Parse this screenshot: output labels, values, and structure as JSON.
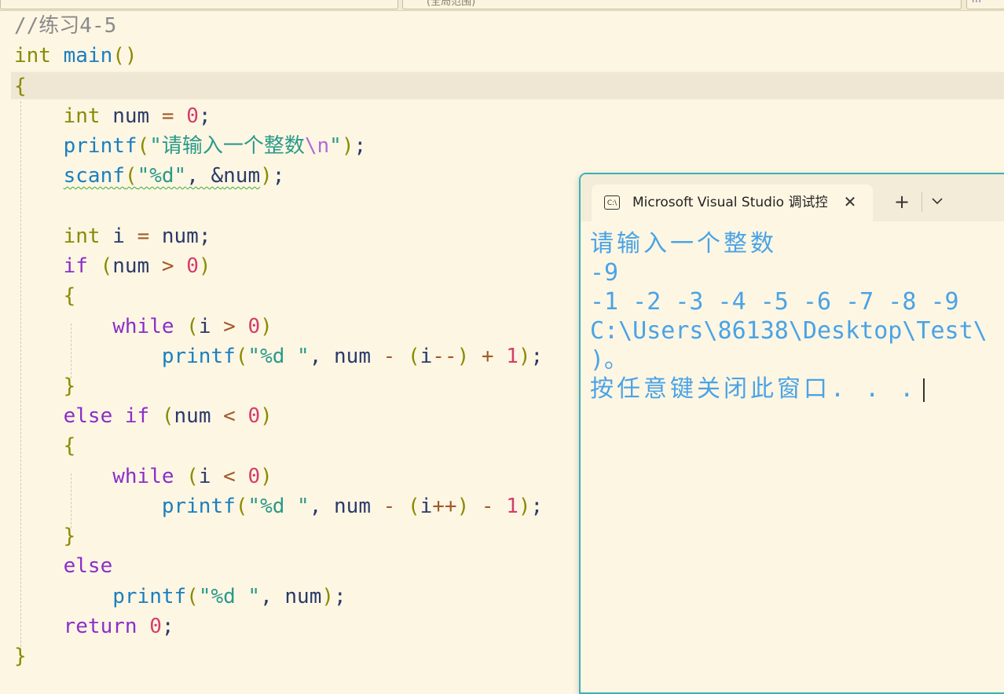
{
  "toolbar": {
    "scope_label": "(全局范围)",
    "right_label": "m"
  },
  "code": {
    "comment": "//练习4-5",
    "kw_int": "int",
    "main": "main",
    "kw_if": "if",
    "kw_else": "else",
    "kw_while": "while",
    "kw_return": "return",
    "printf": "printf",
    "scanf": "scanf",
    "var_num": "num",
    "var_i": "i",
    "zero": "0",
    "one": "1",
    "str_prompt": "\"请输入一个整数",
    "str_escape": "\\n",
    "str_quote_end": "\"",
    "str_fmt_d": "\"%d\"",
    "str_fmt_d_space": "\"%d \""
  },
  "console": {
    "tab_title": "Microsoft Visual Studio 调试控制台",
    "icon_text": "C:\\",
    "close_glyph": "✕",
    "new_tab_glyph": "+",
    "lines": [
      "请输入一个整数",
      "-9",
      "-1 -2 -3 -4 -5 -6 -7 -8 -9",
      "C:\\Users\\86138\\Desktop\\Test\\",
      ")。",
      "按任意键关闭此窗口. . ."
    ]
  },
  "colors": {
    "background": "#fdf6e3",
    "keyword": "#8a8a00",
    "control_keyword": "#8b2fc9",
    "function": "#1a7fbf",
    "string": "#2a9a8a",
    "number": "#d43d6a",
    "console_text": "#4aa3e6",
    "console_border": "#3ab0b8"
  }
}
